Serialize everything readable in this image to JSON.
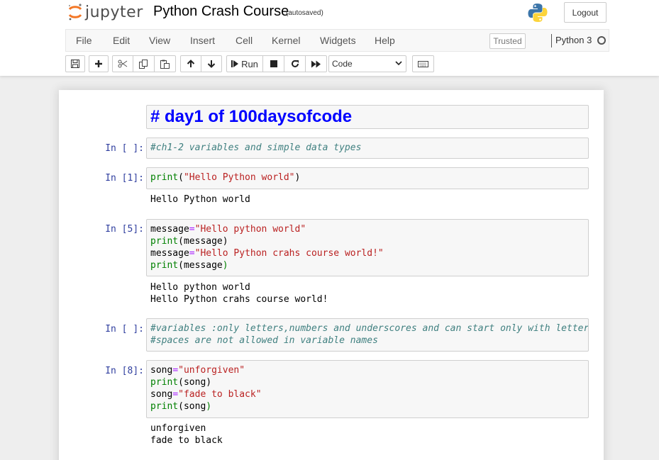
{
  "header": {
    "logo_text": "jupyter",
    "notebook_title": "Python Crash Course",
    "autosave_status": "(autosaved)",
    "logout_label": "Logout"
  },
  "menubar": {
    "items": [
      "File",
      "Edit",
      "View",
      "Insert",
      "Cell",
      "Kernel",
      "Widgets",
      "Help"
    ],
    "trusted_label": "Trusted",
    "kernel_name": "Python 3"
  },
  "toolbar": {
    "run_label": "Run",
    "cell_type": "Code"
  },
  "cells": [
    {
      "type": "markdown",
      "text": "# day1 of 100daysofcode"
    },
    {
      "type": "code",
      "prompt": "In [ ]:",
      "lines": [
        "#ch1-2 variables and simple data types"
      ]
    },
    {
      "type": "code",
      "prompt": "In [1]:",
      "lines": [
        "print(\"Hello Python world\")"
      ],
      "output": [
        "Hello Python world"
      ]
    },
    {
      "type": "code",
      "prompt": "In [5]:",
      "lines": [
        "message=\"Hello python world\"",
        "print(message)",
        "message=\"Hello Python crahs course world!\"",
        "print(message)"
      ],
      "output": [
        "Hello python world",
        "Hello Python crahs course world!"
      ]
    },
    {
      "type": "code",
      "prompt": "In [ ]:",
      "lines": [
        "#variables :only letters,numbers and underscores and can start only with letter",
        "#spaces are not allowed in variable names"
      ]
    },
    {
      "type": "code",
      "prompt": "In [8]:",
      "lines": [
        "song=\"unforgiven\"",
        "print(song)",
        "song=\"fade to black\"",
        "print(song)"
      ],
      "output": [
        "unforgiven",
        "fade to black"
      ]
    }
  ]
}
